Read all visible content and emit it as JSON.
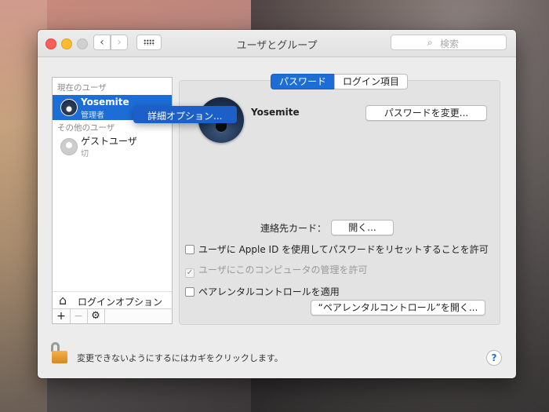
{
  "window": {
    "title": "ユーザとグループ",
    "search_placeholder": "検索",
    "nav_back": "‹",
    "nav_forward": "›"
  },
  "sidebar": {
    "current_users_label": "現在のユーザ",
    "other_users_label": "その他のユーザ",
    "users": [
      {
        "name": "Yosemite",
        "role": "管理者",
        "selected": true
      },
      {
        "name": "ゲストユーザ",
        "role": "切",
        "selected": false
      }
    ],
    "login_options_label": "ログインオプション",
    "footer": {
      "add": "+",
      "remove": "−",
      "gear": "⚙"
    }
  },
  "context_menu": {
    "item": "詳細オプション..."
  },
  "tabs": [
    {
      "label": "パスワード",
      "active": true
    },
    {
      "label": "ログイン項目",
      "active": false
    }
  ],
  "panel": {
    "user_name": "Yosemite",
    "change_password_button": "パスワードを変更...",
    "contact_card_label": "連絡先カード：",
    "open_button": "開く...",
    "checkboxes": [
      {
        "label": "ユーザに Apple ID を使用してパスワードをリセットすることを許可",
        "checked": false,
        "enabled": true
      },
      {
        "label": "ユーザにこのコンピュータの管理を許可",
        "checked": true,
        "enabled": false
      },
      {
        "label": "ペアレンタルコントロールを適用",
        "checked": false,
        "enabled": true
      }
    ],
    "parental_button": "“ペアレンタルコントロール”を開く..."
  },
  "footer": {
    "lock_text": "変更できないようにするにはカギをクリックします。",
    "help": "?"
  },
  "colors": {
    "accent": "#1c6ed6",
    "close": "#fc5f57",
    "minimize": "#fdbc2e"
  }
}
